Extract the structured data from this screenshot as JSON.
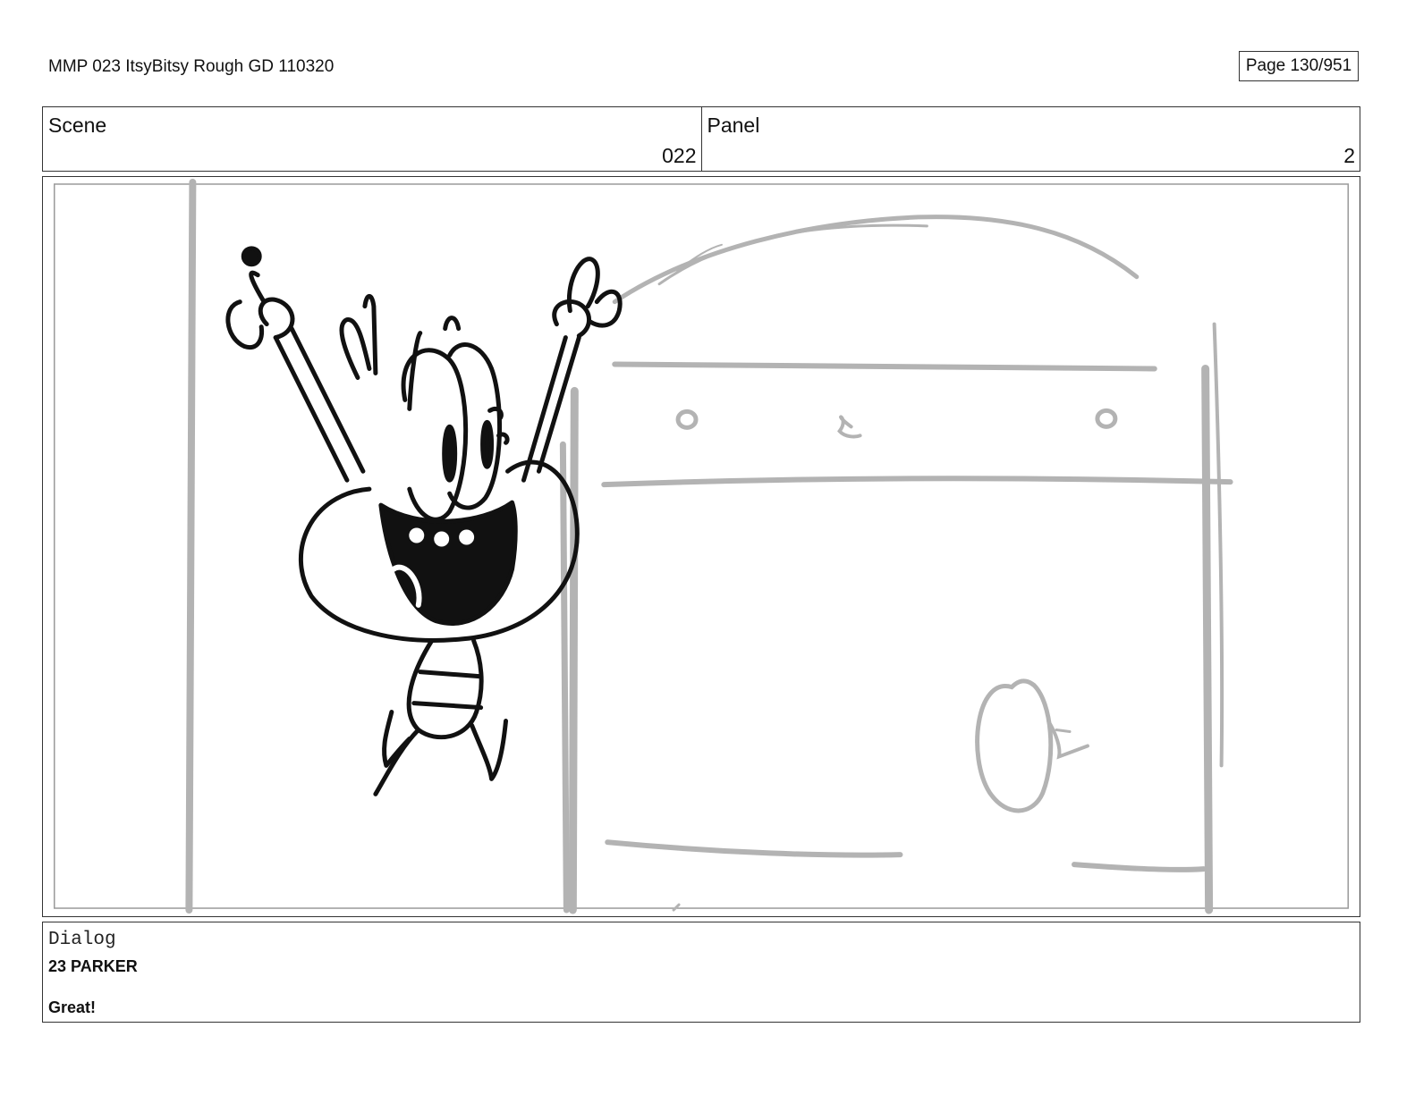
{
  "header": {
    "document_title": "MMP 023 ItsyBitsy Rough GD 110320",
    "page_indicator": "Page 130/951"
  },
  "info": {
    "scene_label": "Scene",
    "scene_value": "022",
    "panel_label": "Panel",
    "panel_value": "2"
  },
  "colors": {
    "ink": "#111111",
    "rough_sketch": "#b3b3b3",
    "border": "#333333"
  },
  "dialog": {
    "label": "Dialog",
    "speaker": "23 PARKER",
    "line": "Great!"
  }
}
